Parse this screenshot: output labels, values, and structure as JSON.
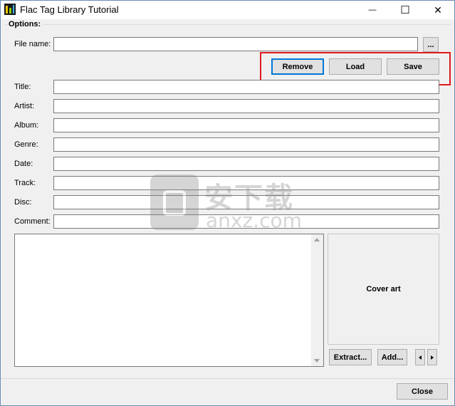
{
  "window": {
    "title": "Flac Tag Library Tutorial",
    "minimize_glyph": "—",
    "maximize_glyph": "☐",
    "close_glyph": "✕"
  },
  "options": {
    "group_label": "Options:",
    "file_name_label": "File name:",
    "file_name_value": "",
    "browse_label": "...",
    "remove_label": "Remove",
    "load_label": "Load",
    "save_label": "Save"
  },
  "fields": {
    "title_label": "Title:",
    "artist_label": "Artist:",
    "album_label": "Album:",
    "genre_label": "Genre:",
    "date_label": "Date:",
    "track_label": "Track:",
    "disc_label": "Disc:",
    "comment_label": "Comment:",
    "title_value": "",
    "artist_value": "",
    "album_value": "",
    "genre_value": "",
    "date_value": "",
    "track_value": "",
    "disc_value": "",
    "comment_value": ""
  },
  "cover": {
    "label": "Cover art",
    "extract_label": "Extract...",
    "add_label": "Add..."
  },
  "footer": {
    "close_label": "Close"
  },
  "watermark": {
    "cn_text": "安下载",
    "en_text": "anxz.com"
  },
  "colors": {
    "highlight_border": "#e0191e",
    "default_button_border": "#0078d7"
  }
}
